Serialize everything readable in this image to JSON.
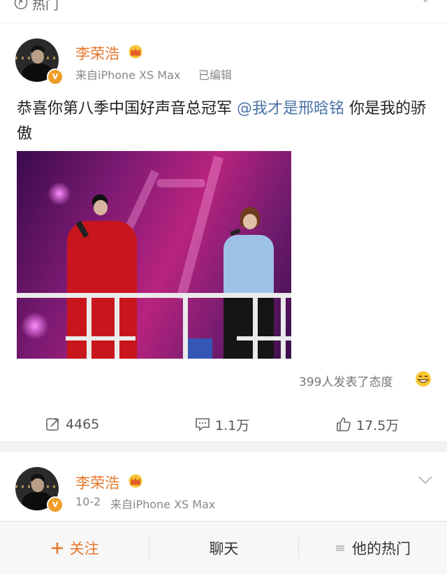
{
  "top": {
    "hot_label": "热门"
  },
  "post": {
    "author": "李荣浩",
    "source": "来自iPhone XS Max",
    "edited": "已编辑",
    "text_before": "恭喜你第八季中国好声音总冠军 ",
    "mention": "@我才是邢晗铭",
    "text_after": "  你是我的骄傲",
    "reactions": "399人发表了态度",
    "actions": {
      "repost": "4465",
      "comment": "1.1万",
      "like": "17.5万"
    }
  },
  "post2": {
    "author": "李荣浩",
    "date": "10-2",
    "source": "来自iPhone XS Max"
  },
  "bottom_bar": {
    "follow": "关注",
    "chat": "聊天",
    "his_hot": "他的热门"
  },
  "colors": {
    "name": "#e5772b",
    "mention": "#4a72a7",
    "vbadge": "#f09d28"
  },
  "icons": [
    "fire-icon",
    "chevron-down-icon",
    "crown-icon",
    "verified-badge-icon",
    "grin-emoji-icon",
    "repost-icon",
    "comment-icon",
    "like-icon",
    "plus-icon",
    "menu-lines-icon"
  ]
}
